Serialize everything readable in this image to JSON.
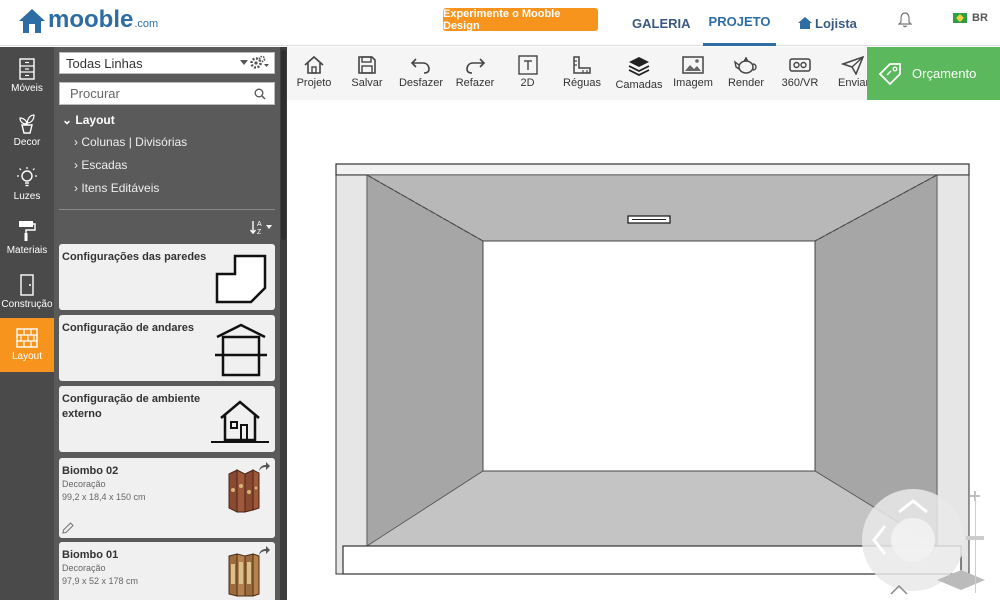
{
  "header": {
    "brand": "mooble",
    "brand_tld": ".com",
    "cta_label": "Experimente o Mooble Design",
    "nav": {
      "galeria": "GALERIA",
      "projeto": "PROJETO",
      "lojista": "Lojista"
    },
    "language": "BR"
  },
  "left_nav": {
    "moveis": "Móveis",
    "decor": "Decor",
    "luzes": "Luzes",
    "materiais": "Materiais",
    "construcao": "Construção",
    "layout": "Layout"
  },
  "panel": {
    "line_filter": "Todas Linhas",
    "search_placeholder": "Procurar",
    "tree": {
      "header": "Layout",
      "items": [
        "Colunas | Divisórias",
        "Escadas",
        "Itens Editáveis"
      ]
    },
    "cards": [
      {
        "title": "Configurações das paredes"
      },
      {
        "title": "Configuração de andares"
      },
      {
        "title": "Configuração de ambiente externo"
      },
      {
        "title": "Biombo 02",
        "category": "Decoração",
        "dimensions": "99,2 x 18,4 x 150 cm"
      },
      {
        "title": "Biombo 01",
        "category": "Decoração",
        "dimensions": "97,9 x 52 x 178 cm"
      }
    ]
  },
  "toolbar": {
    "projeto": "Projeto",
    "salvar": "Salvar",
    "desfazer": "Desfazer",
    "refazer": "Refazer",
    "view2d": "2D",
    "reguas": "Réguas",
    "camadas": "Camadas",
    "imagem": "Imagem",
    "render": "Render",
    "vr": "360/VR",
    "enviar": "Enviar"
  },
  "budget_button": "Orçamento",
  "colors": {
    "accent_orange": "#f7941d",
    "brand_blue": "#2e6da4",
    "budget_green": "#5cb85c",
    "sidebar_dark": "#4a4a4a",
    "panel_gray": "#5a5a5a"
  }
}
